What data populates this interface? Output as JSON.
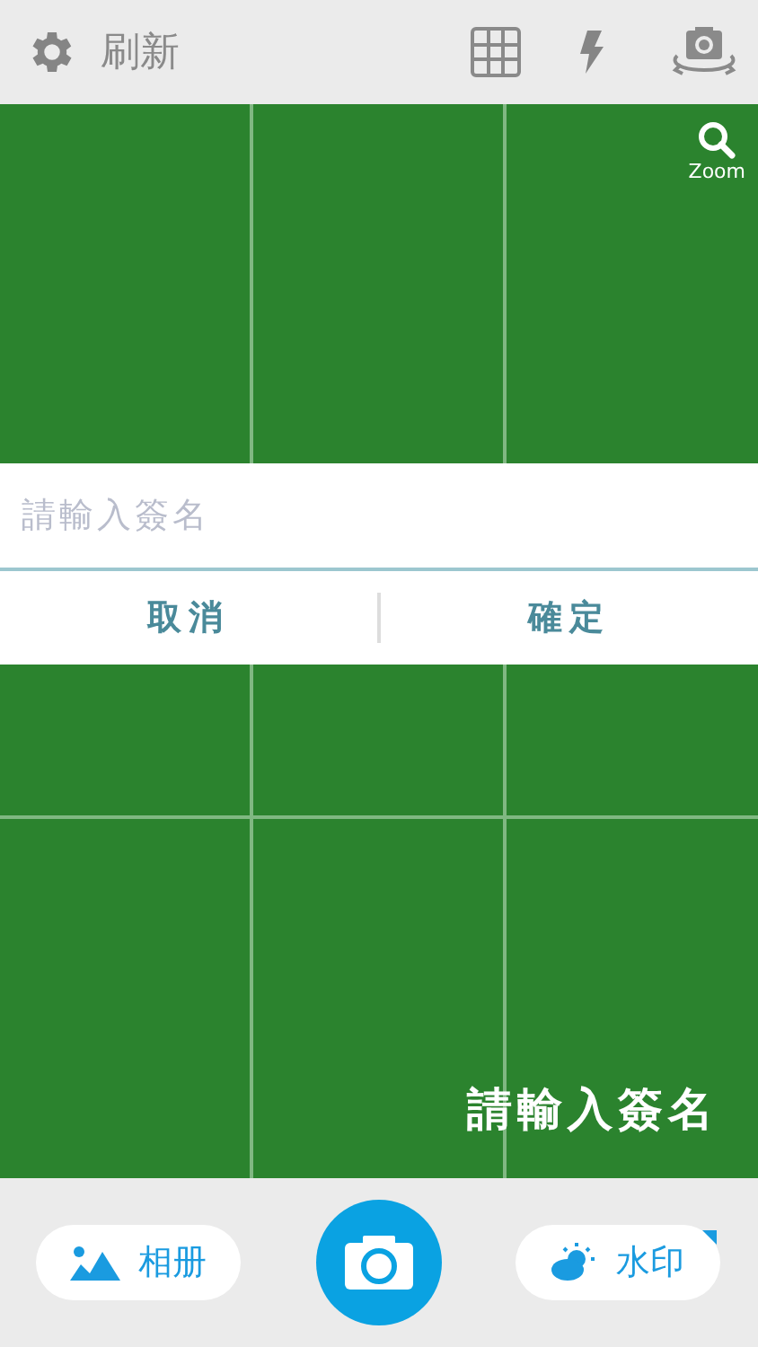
{
  "toolbar": {
    "refresh_label": "刷新"
  },
  "preview": {
    "zoom_label": "Zoom",
    "watermark_text": "請輸入簽名"
  },
  "signature_dialog": {
    "placeholder": "請輸入簽名",
    "buttons": [
      "取消",
      "確定"
    ]
  },
  "bottom_bar": {
    "album_label": "相册",
    "watermark_label": "水印"
  }
}
